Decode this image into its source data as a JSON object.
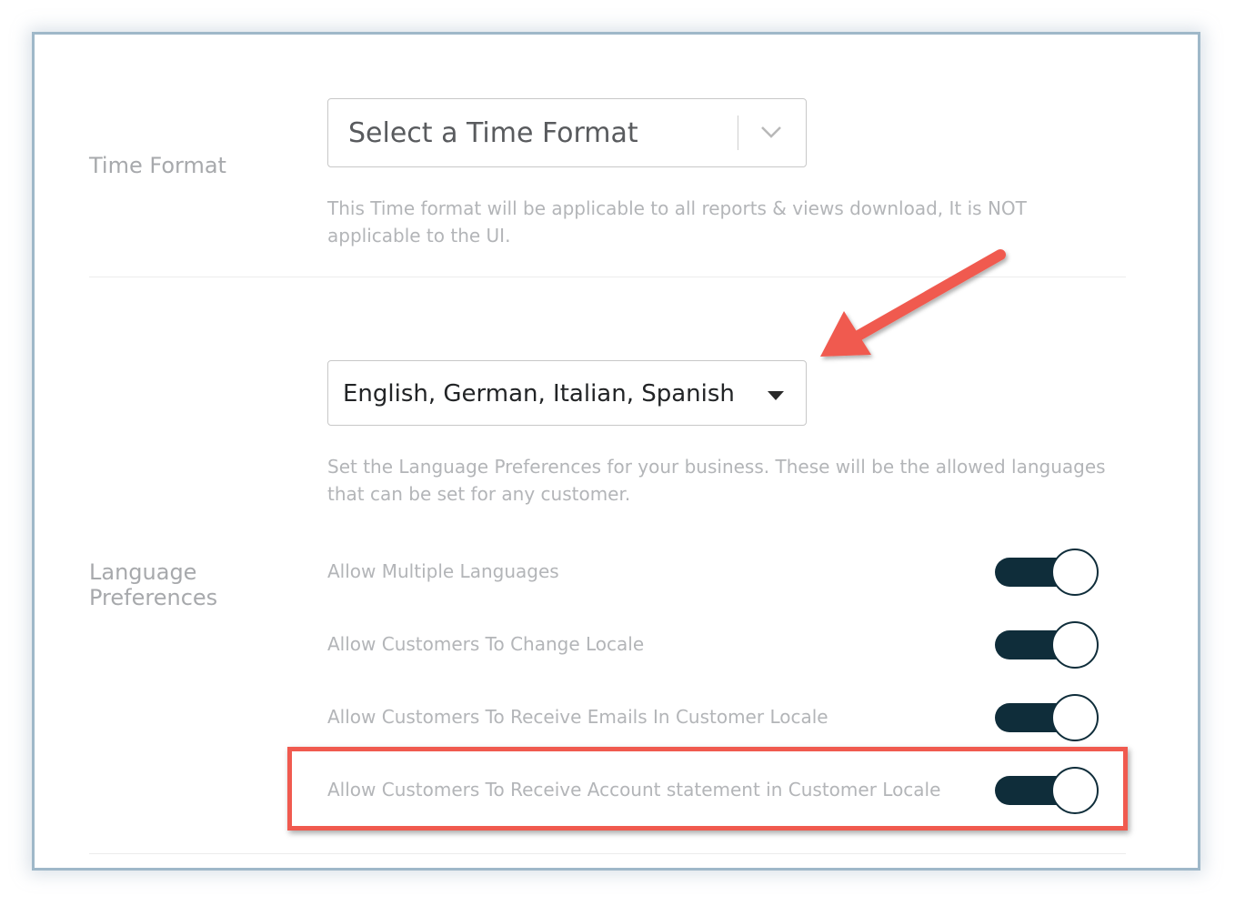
{
  "time_format": {
    "label": "Time Format",
    "select_placeholder": "Select a Time Format",
    "help_text": "This Time format will be applicable to all reports & views download, It is NOT applicable to the UI."
  },
  "language_preferences": {
    "label": "Language Preferences",
    "selected_value": "English, German, Italian, Spanish",
    "help_text": "Set the Language Preferences for your business. These will be the allowed languages that can be set for any customer.",
    "options": [
      {
        "label": "Allow Multiple Languages",
        "enabled": true
      },
      {
        "label": "Allow Customers To Change Locale",
        "enabled": true
      },
      {
        "label": "Allow Customers To Receive Emails In Customer Locale",
        "enabled": true
      },
      {
        "label": "Allow Customers To Receive Account statement in Customer Locale",
        "enabled": true
      }
    ]
  },
  "annotation": {
    "color": "#f05a4f"
  },
  "colors": {
    "toggle_on": "#0f2d3a",
    "label_gray": "#a7a9ac"
  }
}
